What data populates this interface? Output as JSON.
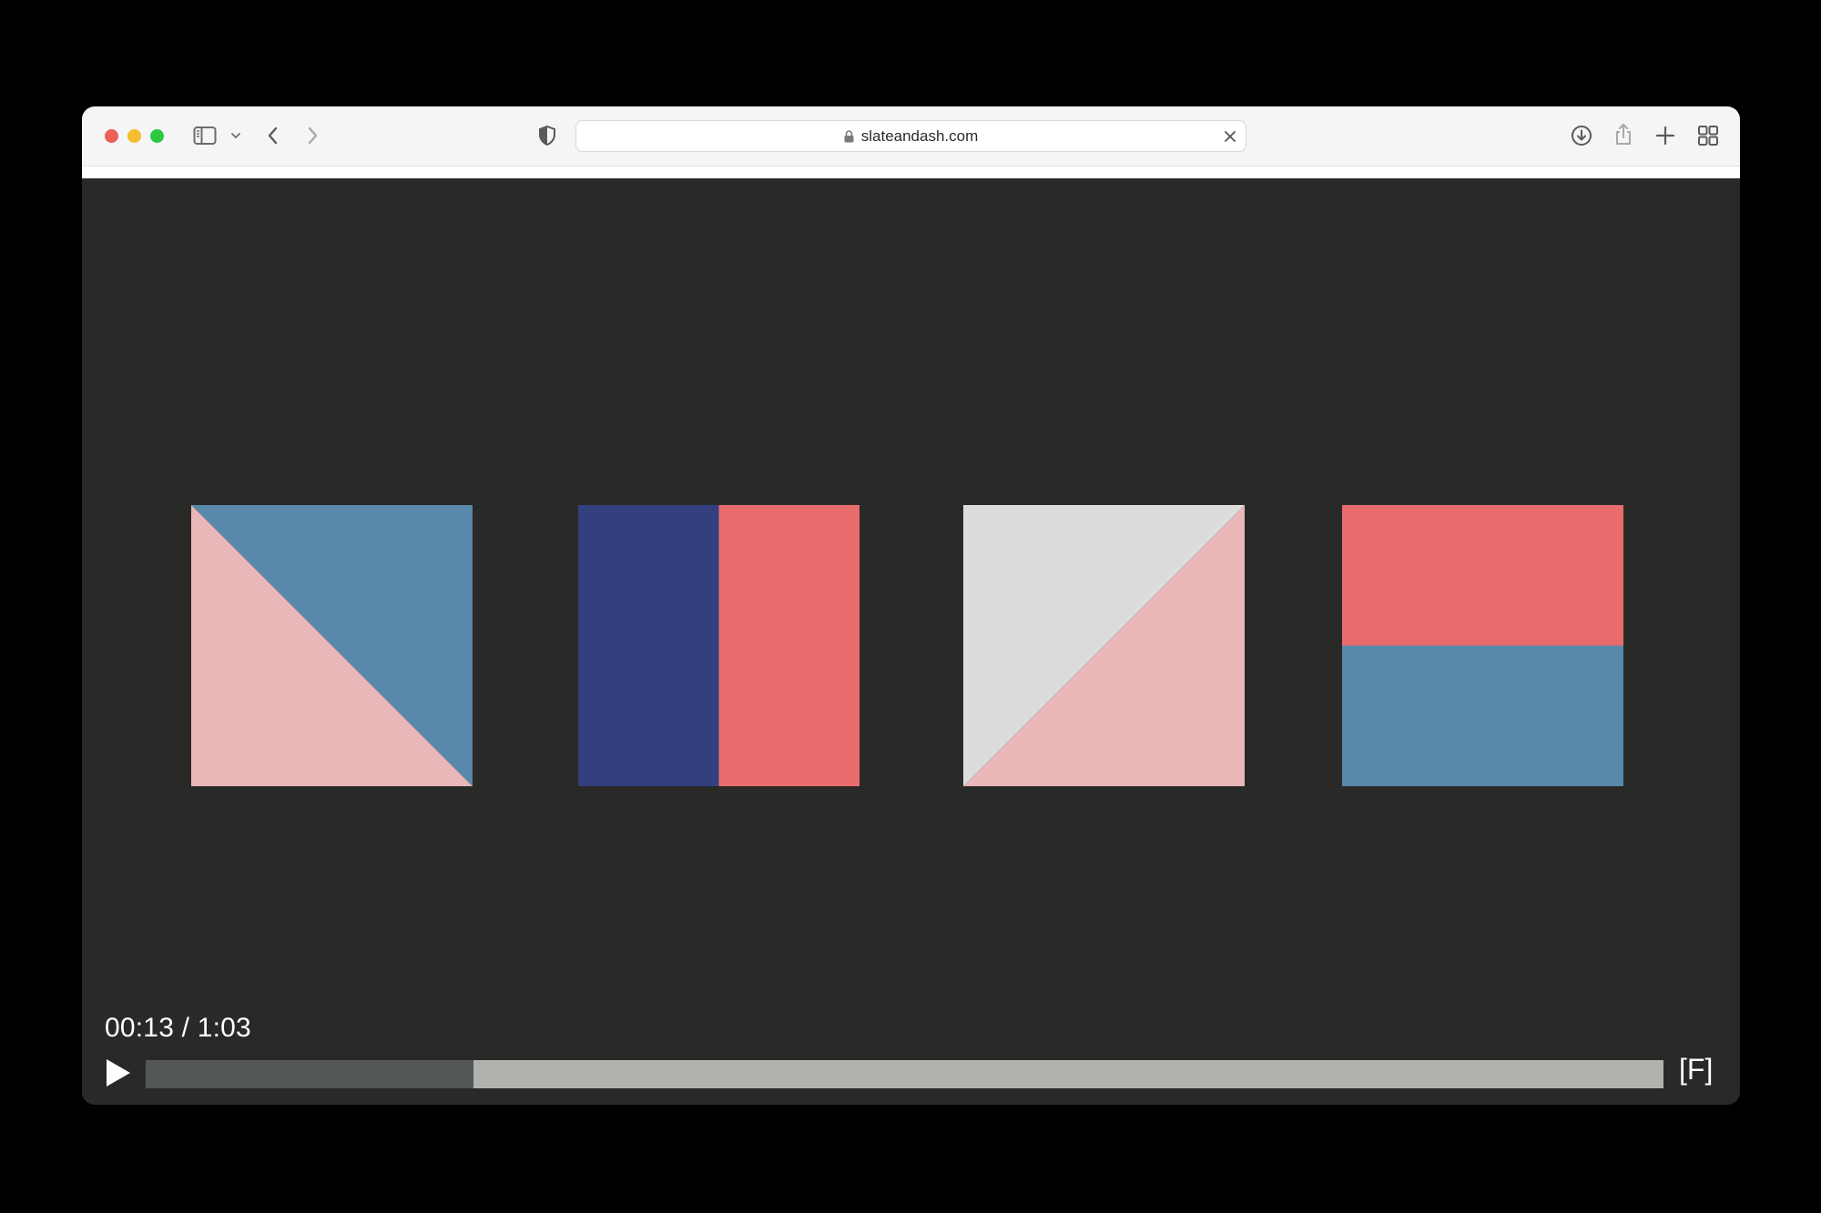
{
  "browser": {
    "url": "slateandash.com",
    "icons": {
      "sidebar": "sidebar-icon",
      "sidebar_menu": "chevron-down-icon",
      "back": "chevron-left-icon",
      "forward": "chevron-right-icon",
      "privacy": "shield-icon",
      "lock": "lock-icon",
      "clear": "close-icon",
      "downloads": "download-icon",
      "share": "share-icon",
      "new_tab": "plus-icon",
      "tab_overview": "grid-icon"
    }
  },
  "player": {
    "current_time": "00:13",
    "separator": "/",
    "duration": "1:03",
    "progress_fraction": 0.216,
    "fullscreen_label": "[F]",
    "play_icon": "play-icon"
  },
  "colors": {
    "background": "#292928",
    "steel_blue": "#5888aa",
    "pink": "#e9b7b8",
    "navy": "#333f7f",
    "coral": "#e96c6d",
    "light_gray": "#dcdcdc"
  },
  "tiles": [
    {
      "split": "diagonal-down",
      "colors": [
        "#5888aa",
        "#e9b7b8"
      ]
    },
    {
      "split": "vertical",
      "colors": [
        "#333f7f",
        "#e96c6d"
      ]
    },
    {
      "split": "diagonal-up",
      "colors": [
        "#dcdcdc",
        "#e9b7b8"
      ]
    },
    {
      "split": "horizontal",
      "colors": [
        "#e96c6d",
        "#5888aa"
      ]
    }
  ]
}
